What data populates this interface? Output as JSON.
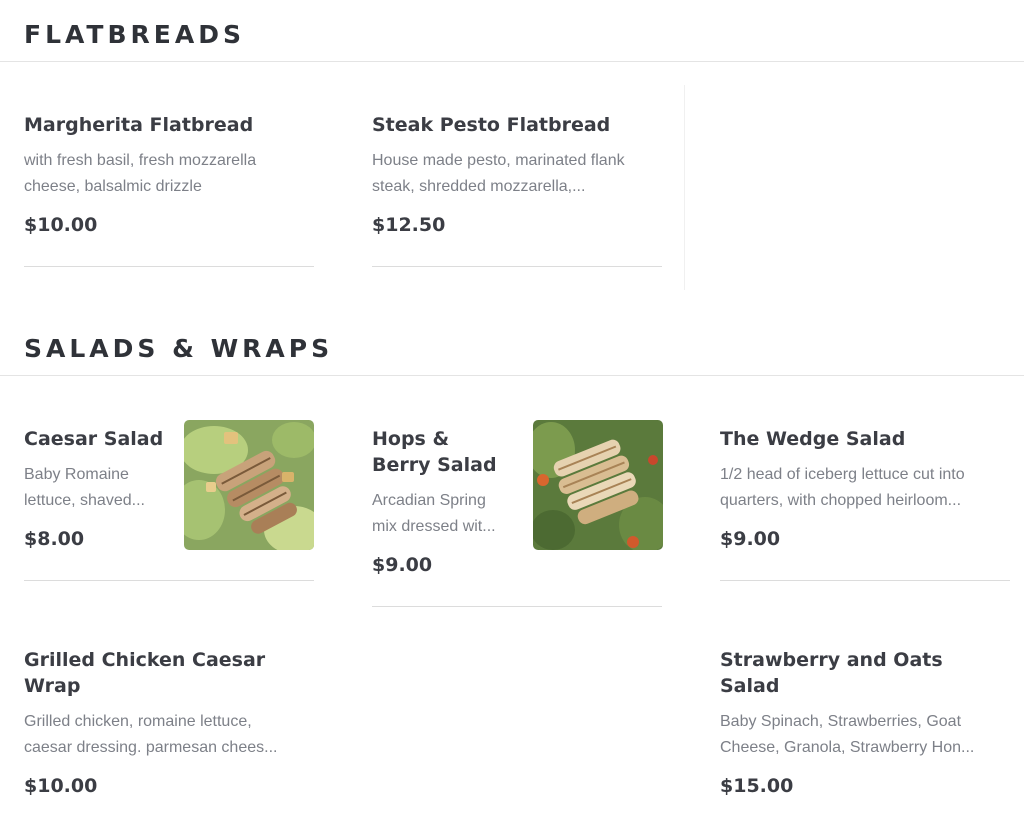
{
  "sections": [
    {
      "title": "FLATBREADS",
      "items": [
        {
          "name": "Margherita Flatbread",
          "description": "with fresh basil, fresh mozzarella cheese, balsalmic drizzle",
          "price": "$10.00"
        },
        {
          "name": "Steak Pesto Flatbread",
          "description": "House made pesto, marinated flank steak, shredded mozzarella,...",
          "price": "$12.50"
        }
      ]
    },
    {
      "title": "SALADS & WRAPS",
      "items": [
        {
          "name": "Caesar Salad",
          "description": "Baby Romaine lettuce, shaved...",
          "price": "$8.00",
          "image_icon": "caesar-salad-photo"
        },
        {
          "name": "Hops & Berry Salad",
          "description": "Arcadian Spring mix dressed wit...",
          "price": "$9.00",
          "image_icon": "hops-berry-salad-photo"
        },
        {
          "name": "The Wedge Salad",
          "description": "1/2 head of iceberg lettuce cut into quarters, with chopped heirloom...",
          "price": "$9.00"
        },
        {
          "name": "Grilled Chicken Caesar Wrap",
          "description": "Grilled chicken, romaine lettuce, caesar dressing. parmesan chees...",
          "price": "$10.00"
        },
        {
          "name": "Strawberry and Oats Salad",
          "description": "Baby Spinach, Strawberries, Goat Cheese, Granola, Strawberry Hon...",
          "price": "$15.00"
        }
      ]
    }
  ]
}
